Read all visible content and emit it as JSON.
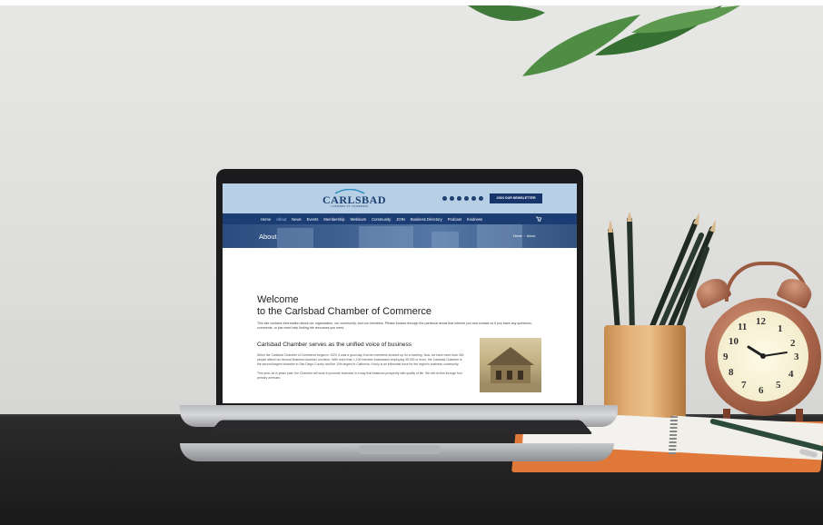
{
  "site": {
    "logo": {
      "name": "CARLSBAD",
      "sub": "CHAMBER OF COMMERCE"
    },
    "newsletter_button": "JOIN OUR NEWSLETTER",
    "nav": [
      "Home",
      "About",
      "News",
      "Events",
      "Membership",
      "Webinars",
      "Community",
      "JOIN",
      "Business Directory",
      "Podcast",
      "Kindness"
    ],
    "active_nav": "About",
    "banner": {
      "title": "About",
      "breadcrumb_home": "Home",
      "breadcrumb_current": "About"
    },
    "content": {
      "heading_line1": "Welcome",
      "heading_line2": "to the Carlsbad Chamber of Commerce",
      "intro": "This site contains information about our organization, our community, and our members. Please browse through the particular areas that interest you and contact us if you have any questions, comments, or just need help finding the resources you need.",
      "subheading": "Carlsbad Chamber serves as the unified voice of business",
      "paragraph1": "When the Carlsbad Chamber of Commerce began in 1923, it was a good day if seven members showed up for a meeting. Now, we have more than 300 people attend our Annual Business Awards Luncheon. With more than 1,100 member businesses employing 35,000 or more, the Carlsbad Chamber is the second largest chamber in San Diego County and the 10th largest in California. It truly is an influential force for the region's business community.",
      "paragraph2": "This year, as in years past, the Chamber will work to promote business in a way that balances prosperity with quality of life. We will do this through four primary avenues:"
    }
  },
  "clock_numbers": [
    "12",
    "1",
    "2",
    "3",
    "4",
    "5",
    "6",
    "7",
    "8",
    "9",
    "10",
    "11"
  ],
  "colors": {
    "nav": "#1b3d73",
    "header": "#b7d0e6",
    "notebook": "#e0783a",
    "cup": "#e2b27a"
  }
}
